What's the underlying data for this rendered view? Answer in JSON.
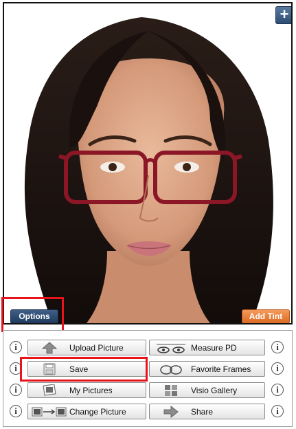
{
  "viewer": {
    "plus_label": "+",
    "options_label": "Options",
    "add_tint_label": "Add Tint"
  },
  "actions": {
    "upload_picture": "Upload Picture",
    "measure_pd": "Measure PD",
    "save": "Save",
    "favorite_frames": "Favorite Frames",
    "my_pictures": "My Pictures",
    "visio_gallery": "Visio Gallery",
    "change_picture": "Change Picture",
    "share": "Share"
  },
  "info_glyph": "i",
  "colors": {
    "highlight": "#e8141b",
    "options_button": "#2b4a70",
    "add_tint_button": "#e87a35",
    "frame_color": "#8a1626"
  }
}
